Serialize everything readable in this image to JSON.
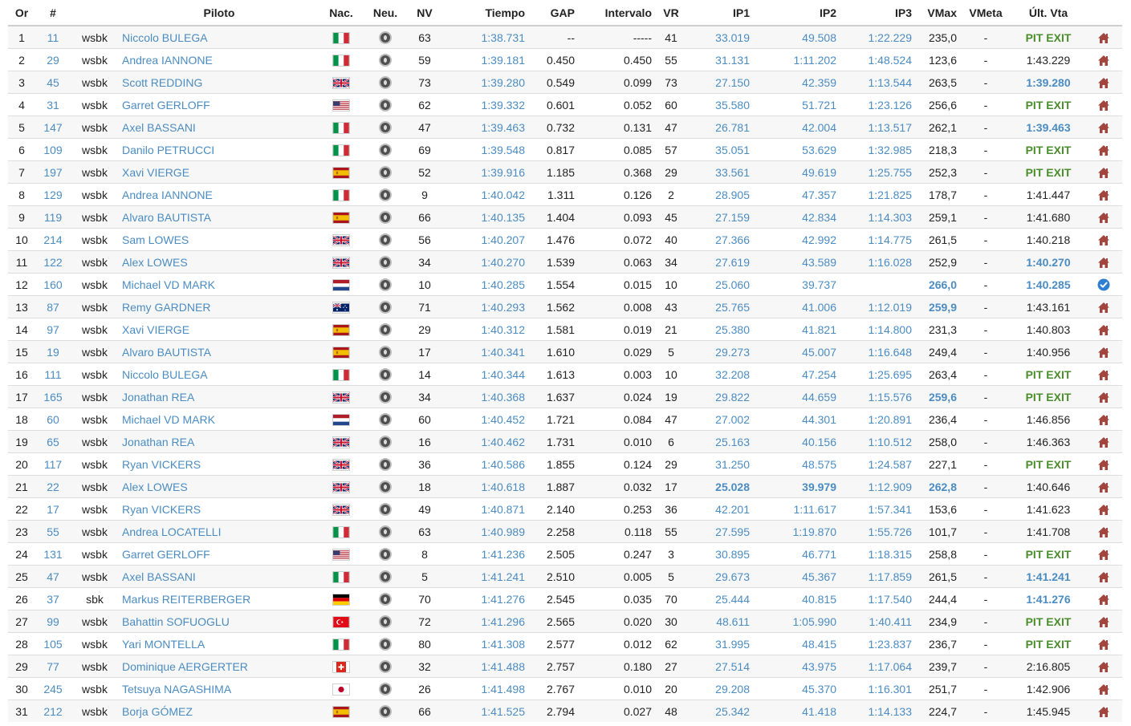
{
  "headers": {
    "pos": "Or",
    "num": "#",
    "pilot": "Piloto",
    "nat": "Nac.",
    "tyre": "Neu.",
    "nv": "NV",
    "time": "Tiempo",
    "gap": "GAP",
    "interval": "Intervalo",
    "vr": "VR",
    "ip1": "IP1",
    "ip2": "IP2",
    "ip3": "IP3",
    "vmax": "VMax",
    "vmeta": "VMeta",
    "last": "Últ. Vta"
  },
  "colors": {
    "link": "#4b8cc2",
    "pit": "#4a8d2c",
    "home": "#a0463d",
    "check": "#2f7fd1"
  },
  "rows": [
    {
      "pos": "1",
      "num": "11",
      "cls": "wsbk",
      "name": "Niccolo BULEGA",
      "flag": "it",
      "nv": "63",
      "time": "1:38.731",
      "gap": "--",
      "interval": "-----",
      "vr": "41",
      "ip1": "33.019",
      "ip2": "49.508",
      "ip3": "1:22.229",
      "vmax": "235,0",
      "vmeta": "-",
      "last": "PIT EXIT",
      "last_style": "pit",
      "icon": "home-icon"
    },
    {
      "pos": "2",
      "num": "29",
      "cls": "wsbk",
      "name": "Andrea IANNONE",
      "flag": "it",
      "nv": "59",
      "time": "1:39.181",
      "gap": "0.450",
      "interval": "0.450",
      "vr": "55",
      "ip1": "31.131",
      "ip2": "1:11.202",
      "ip3": "1:48.524",
      "vmax": "123,6",
      "vmeta": "-",
      "last": "1:43.229",
      "last_style": "",
      "icon": "home-icon"
    },
    {
      "pos": "3",
      "num": "45",
      "cls": "wsbk",
      "name": "Scott REDDING",
      "flag": "gb",
      "nv": "73",
      "time": "1:39.280",
      "gap": "0.549",
      "interval": "0.099",
      "vr": "73",
      "ip1": "27.150",
      "ip2": "42.359",
      "ip3": "1:13.544",
      "vmax": "263,5",
      "vmeta": "-",
      "last": "1:39.280",
      "last_style": "hl",
      "icon": "home-icon"
    },
    {
      "pos": "4",
      "num": "31",
      "cls": "wsbk",
      "name": "Garret GERLOFF",
      "flag": "us",
      "nv": "62",
      "time": "1:39.332",
      "gap": "0.601",
      "interval": "0.052",
      "vr": "60",
      "ip1": "35.580",
      "ip2": "51.721",
      "ip3": "1:23.126",
      "vmax": "256,6",
      "vmeta": "-",
      "last": "PIT EXIT",
      "last_style": "pit",
      "icon": "home-icon"
    },
    {
      "pos": "5",
      "num": "147",
      "cls": "wsbk",
      "name": "Axel BASSANI",
      "flag": "it",
      "nv": "47",
      "time": "1:39.463",
      "gap": "0.732",
      "interval": "0.131",
      "vr": "47",
      "ip1": "26.781",
      "ip2": "42.004",
      "ip3": "1:13.517",
      "vmax": "262,1",
      "vmeta": "-",
      "last": "1:39.463",
      "last_style": "hl",
      "icon": "home-icon"
    },
    {
      "pos": "6",
      "num": "109",
      "cls": "wsbk",
      "name": "Danilo PETRUCCI",
      "flag": "it",
      "nv": "69",
      "time": "1:39.548",
      "gap": "0.817",
      "interval": "0.085",
      "vr": "57",
      "ip1": "35.051",
      "ip2": "53.629",
      "ip3": "1:32.985",
      "vmax": "218,3",
      "vmeta": "-",
      "last": "PIT EXIT",
      "last_style": "pit",
      "icon": "home-icon"
    },
    {
      "pos": "7",
      "num": "197",
      "cls": "wsbk",
      "name": "Xavi VIERGE",
      "flag": "es",
      "nv": "52",
      "time": "1:39.916",
      "gap": "1.185",
      "interval": "0.368",
      "vr": "29",
      "ip1": "33.561",
      "ip2": "49.619",
      "ip3": "1:25.755",
      "vmax": "252,3",
      "vmeta": "-",
      "last": "PIT EXIT",
      "last_style": "pit",
      "icon": "home-icon"
    },
    {
      "pos": "8",
      "num": "129",
      "cls": "wsbk",
      "name": "Andrea IANNONE",
      "flag": "it",
      "nv": "9",
      "time": "1:40.042",
      "gap": "1.311",
      "interval": "0.126",
      "vr": "2",
      "ip1": "28.905",
      "ip2": "47.357",
      "ip3": "1:21.825",
      "vmax": "178,7",
      "vmeta": "-",
      "last": "1:41.447",
      "last_style": "",
      "icon": "home-icon"
    },
    {
      "pos": "9",
      "num": "119",
      "cls": "wsbk",
      "name": "Alvaro BAUTISTA",
      "flag": "es",
      "nv": "66",
      "time": "1:40.135",
      "gap": "1.404",
      "interval": "0.093",
      "vr": "45",
      "ip1": "27.159",
      "ip2": "42.834",
      "ip3": "1:14.303",
      "vmax": "259,1",
      "vmeta": "-",
      "last": "1:41.680",
      "last_style": "",
      "icon": "home-icon"
    },
    {
      "pos": "10",
      "num": "214",
      "cls": "wsbk",
      "name": "Sam LOWES",
      "flag": "gb",
      "nv": "56",
      "time": "1:40.207",
      "gap": "1.476",
      "interval": "0.072",
      "vr": "40",
      "ip1": "27.366",
      "ip2": "42.992",
      "ip3": "1:14.775",
      "vmax": "261,5",
      "vmeta": "-",
      "last": "1:40.218",
      "last_style": "",
      "icon": "home-icon"
    },
    {
      "pos": "11",
      "num": "122",
      "cls": "wsbk",
      "name": "Alex LOWES",
      "flag": "gb",
      "nv": "34",
      "time": "1:40.270",
      "gap": "1.539",
      "interval": "0.063",
      "vr": "34",
      "ip1": "27.619",
      "ip2": "43.589",
      "ip3": "1:16.028",
      "vmax": "252,9",
      "vmeta": "-",
      "last": "1:40.270",
      "last_style": "hl",
      "icon": "home-icon"
    },
    {
      "pos": "12",
      "num": "160",
      "cls": "wsbk",
      "name": "Michael VD MARK",
      "flag": "nl",
      "nv": "10",
      "time": "1:40.285",
      "gap": "1.554",
      "interval": "0.015",
      "vr": "10",
      "ip1": "25.060",
      "ip2": "39.737",
      "ip3": "",
      "vmax": "266,0",
      "vmax_style": "hl",
      "vmeta": "-",
      "last": "1:40.285",
      "last_style": "hl",
      "icon": "check-circle-icon"
    },
    {
      "pos": "13",
      "num": "87",
      "cls": "wsbk",
      "name": "Remy GARDNER",
      "flag": "au",
      "nv": "71",
      "time": "1:40.293",
      "gap": "1.562",
      "interval": "0.008",
      "vr": "43",
      "ip1": "25.765",
      "ip2": "41.006",
      "ip3": "1:12.019",
      "vmax": "259,9",
      "vmax_style": "hl",
      "vmeta": "-",
      "last": "1:43.161",
      "last_style": "",
      "icon": "home-icon"
    },
    {
      "pos": "14",
      "num": "97",
      "cls": "wsbk",
      "name": "Xavi VIERGE",
      "flag": "es",
      "nv": "29",
      "time": "1:40.312",
      "gap": "1.581",
      "interval": "0.019",
      "vr": "21",
      "ip1": "25.380",
      "ip2": "41.821",
      "ip3": "1:14.800",
      "vmax": "231,3",
      "vmeta": "-",
      "last": "1:40.803",
      "last_style": "",
      "icon": "home-icon"
    },
    {
      "pos": "15",
      "num": "19",
      "cls": "wsbk",
      "name": "Alvaro BAUTISTA",
      "flag": "es",
      "nv": "17",
      "time": "1:40.341",
      "gap": "1.610",
      "interval": "0.029",
      "vr": "5",
      "ip1": "29.273",
      "ip2": "45.007",
      "ip3": "1:16.648",
      "vmax": "249,4",
      "vmeta": "-",
      "last": "1:40.956",
      "last_style": "",
      "icon": "home-icon"
    },
    {
      "pos": "16",
      "num": "111",
      "cls": "wsbk",
      "name": "Niccolo BULEGA",
      "flag": "it",
      "nv": "14",
      "time": "1:40.344",
      "gap": "1.613",
      "interval": "0.003",
      "vr": "10",
      "ip1": "32.208",
      "ip2": "47.254",
      "ip3": "1:25.695",
      "vmax": "263,4",
      "vmeta": "-",
      "last": "PIT EXIT",
      "last_style": "pit",
      "icon": "home-icon"
    },
    {
      "pos": "17",
      "num": "165",
      "cls": "wsbk",
      "name": "Jonathan REA",
      "flag": "gb",
      "nv": "34",
      "time": "1:40.368",
      "gap": "1.637",
      "interval": "0.024",
      "vr": "19",
      "ip1": "29.822",
      "ip2": "44.659",
      "ip3": "1:15.576",
      "vmax": "259,6",
      "vmax_style": "hl",
      "vmeta": "-",
      "last": "PIT EXIT",
      "last_style": "pit",
      "icon": "home-icon"
    },
    {
      "pos": "18",
      "num": "60",
      "cls": "wsbk",
      "name": "Michael VD MARK",
      "flag": "nl",
      "nv": "60",
      "time": "1:40.452",
      "gap": "1.721",
      "interval": "0.084",
      "vr": "47",
      "ip1": "27.002",
      "ip2": "44.301",
      "ip3": "1:20.891",
      "vmax": "236,4",
      "vmeta": "-",
      "last": "1:46.856",
      "last_style": "",
      "icon": "home-icon"
    },
    {
      "pos": "19",
      "num": "65",
      "cls": "wsbk",
      "name": "Jonathan REA",
      "flag": "gb",
      "nv": "16",
      "time": "1:40.462",
      "gap": "1.731",
      "interval": "0.010",
      "vr": "6",
      "ip1": "25.163",
      "ip2": "40.156",
      "ip3": "1:10.512",
      "vmax": "258,0",
      "vmeta": "-",
      "last": "1:46.363",
      "last_style": "",
      "icon": "home-icon"
    },
    {
      "pos": "20",
      "num": "117",
      "cls": "wsbk",
      "name": "Ryan VICKERS",
      "flag": "gb",
      "nv": "36",
      "time": "1:40.586",
      "gap": "1.855",
      "interval": "0.124",
      "vr": "29",
      "ip1": "31.250",
      "ip2": "48.575",
      "ip3": "1:24.587",
      "vmax": "227,1",
      "vmeta": "-",
      "last": "PIT EXIT",
      "last_style": "pit",
      "icon": "home-icon"
    },
    {
      "pos": "21",
      "num": "22",
      "cls": "wsbk",
      "name": "Alex LOWES",
      "flag": "gb",
      "nv": "18",
      "time": "1:40.618",
      "gap": "1.887",
      "interval": "0.032",
      "vr": "17",
      "ip1": "25.028",
      "ip1_style": "hl",
      "ip2": "39.979",
      "ip2_style": "hl",
      "ip3": "1:12.909",
      "vmax": "262,8",
      "vmax_style": "hl",
      "vmeta": "-",
      "last": "1:40.646",
      "last_style": "",
      "icon": "home-icon"
    },
    {
      "pos": "22",
      "num": "17",
      "cls": "wsbk",
      "name": "Ryan VICKERS",
      "flag": "gb",
      "nv": "49",
      "time": "1:40.871",
      "gap": "2.140",
      "interval": "0.253",
      "vr": "36",
      "ip1": "42.201",
      "ip2": "1:11.617",
      "ip3": "1:57.341",
      "vmax": "153,6",
      "vmeta": "-",
      "last": "1:41.623",
      "last_style": "",
      "icon": "home-icon"
    },
    {
      "pos": "23",
      "num": "55",
      "cls": "wsbk",
      "name": "Andrea LOCATELLI",
      "flag": "it",
      "nv": "63",
      "time": "1:40.989",
      "gap": "2.258",
      "interval": "0.118",
      "vr": "55",
      "ip1": "27.595",
      "ip2": "1:19.870",
      "ip3": "1:55.726",
      "vmax": "101,7",
      "vmeta": "-",
      "last": "1:41.708",
      "last_style": "",
      "icon": "home-icon"
    },
    {
      "pos": "24",
      "num": "131",
      "cls": "wsbk",
      "name": "Garret GERLOFF",
      "flag": "us",
      "nv": "8",
      "time": "1:41.236",
      "gap": "2.505",
      "interval": "0.247",
      "vr": "3",
      "ip1": "30.895",
      "ip2": "46.771",
      "ip3": "1:18.315",
      "vmax": "258,8",
      "vmeta": "-",
      "last": "PIT EXIT",
      "last_style": "pit",
      "icon": "home-icon"
    },
    {
      "pos": "25",
      "num": "47",
      "cls": "wsbk",
      "name": "Axel BASSANI",
      "flag": "it",
      "nv": "5",
      "time": "1:41.241",
      "gap": "2.510",
      "interval": "0.005",
      "vr": "5",
      "ip1": "29.673",
      "ip2": "45.367",
      "ip3": "1:17.859",
      "vmax": "261,5",
      "vmeta": "-",
      "last": "1:41.241",
      "last_style": "hl",
      "icon": "home-icon"
    },
    {
      "pos": "26",
      "num": "37",
      "cls": "sbk",
      "name": "Markus REITERBERGER",
      "flag": "de",
      "nv": "70",
      "time": "1:41.276",
      "gap": "2.545",
      "interval": "0.035",
      "vr": "70",
      "ip1": "25.444",
      "ip2": "40.815",
      "ip3": "1:17.540",
      "vmax": "244,4",
      "vmeta": "-",
      "last": "1:41.276",
      "last_style": "hl",
      "icon": "home-icon"
    },
    {
      "pos": "27",
      "num": "99",
      "cls": "wsbk",
      "name": "Bahattin SOFUOGLU",
      "flag": "tr",
      "nv": "72",
      "time": "1:41.296",
      "gap": "2.565",
      "interval": "0.020",
      "vr": "30",
      "ip1": "48.611",
      "ip2": "1:05.990",
      "ip3": "1:40.411",
      "vmax": "234,9",
      "vmeta": "-",
      "last": "PIT EXIT",
      "last_style": "pit",
      "icon": "home-icon"
    },
    {
      "pos": "28",
      "num": "105",
      "cls": "wsbk",
      "name": "Yari MONTELLA",
      "flag": "it",
      "nv": "80",
      "time": "1:41.308",
      "gap": "2.577",
      "interval": "0.012",
      "vr": "62",
      "ip1": "31.995",
      "ip2": "48.415",
      "ip3": "1:23.837",
      "vmax": "236,7",
      "vmeta": "-",
      "last": "PIT EXIT",
      "last_style": "pit",
      "icon": "home-icon"
    },
    {
      "pos": "29",
      "num": "77",
      "cls": "wsbk",
      "name": "Dominique AERGERTER",
      "flag": "ch",
      "nv": "32",
      "time": "1:41.488",
      "gap": "2.757",
      "interval": "0.180",
      "vr": "27",
      "ip1": "27.514",
      "ip2": "43.975",
      "ip3": "1:17.064",
      "vmax": "239,7",
      "vmeta": "-",
      "last": "2:16.805",
      "last_style": "",
      "icon": "home-icon"
    },
    {
      "pos": "30",
      "num": "245",
      "cls": "wsbk",
      "name": "Tetsuya NAGASHIMA",
      "flag": "jp",
      "nv": "26",
      "time": "1:41.498",
      "gap": "2.767",
      "interval": "0.010",
      "vr": "20",
      "ip1": "29.208",
      "ip2": "45.370",
      "ip3": "1:16.301",
      "vmax": "251,7",
      "vmeta": "-",
      "last": "1:42.906",
      "last_style": "",
      "icon": "home-icon"
    },
    {
      "pos": "31",
      "num": "212",
      "cls": "wsbk",
      "name": "Borja GÓMEZ",
      "flag": "es",
      "nv": "66",
      "time": "1:41.525",
      "gap": "2.794",
      "interval": "0.027",
      "vr": "48",
      "ip1": "25.342",
      "ip2": "41.418",
      "ip3": "1:14.133",
      "vmax": "224,7",
      "vmeta": "-",
      "last": "1:45.945",
      "last_style": "",
      "icon": "home-icon"
    }
  ]
}
